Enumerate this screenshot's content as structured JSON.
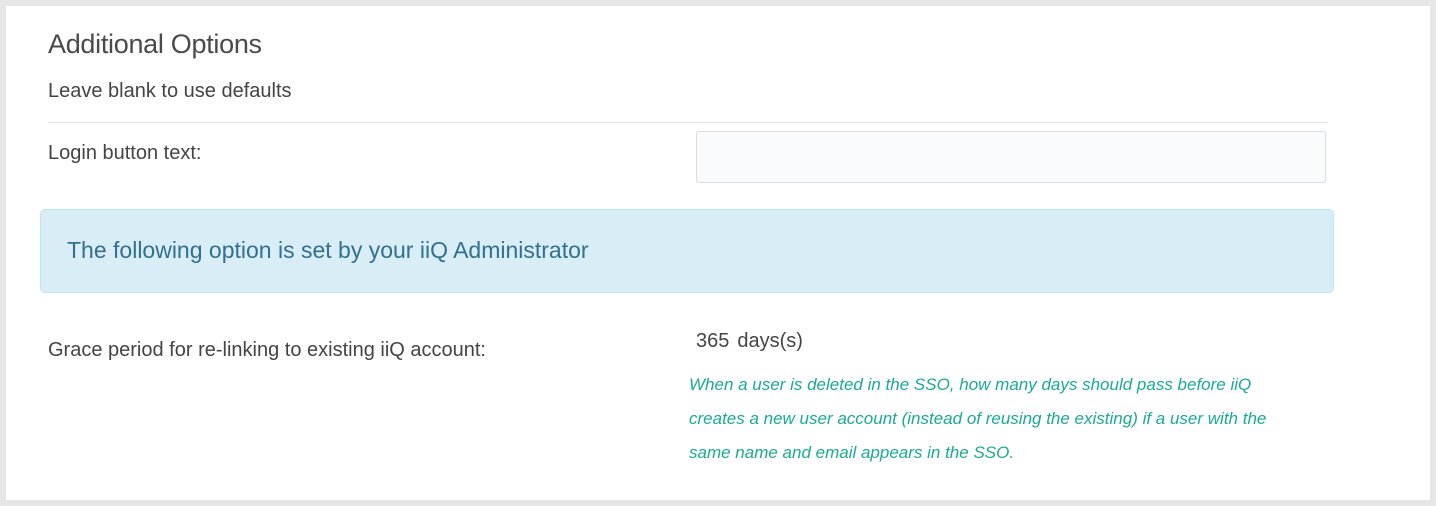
{
  "section": {
    "title": "Additional Options",
    "subtitle": "Leave blank to use defaults"
  },
  "login_button": {
    "label": "Login button text:",
    "value": "",
    "placeholder": ""
  },
  "admin_notice": {
    "text": "The following option is set by your iiQ Administrator"
  },
  "grace_period": {
    "label": "Grace period for re-linking to existing iiQ account:",
    "value": "365",
    "unit": "days(s)",
    "help": "When a user is deleted in the SSO, how many days should pass before iiQ creates a new user account (instead of reusing the existing) if a user with the same name and email appears in the SSO."
  },
  "colors": {
    "info_background": "#d9edf7",
    "info_border": "#bce8f1",
    "info_text": "#31708f",
    "help_text": "#1aaa95"
  }
}
